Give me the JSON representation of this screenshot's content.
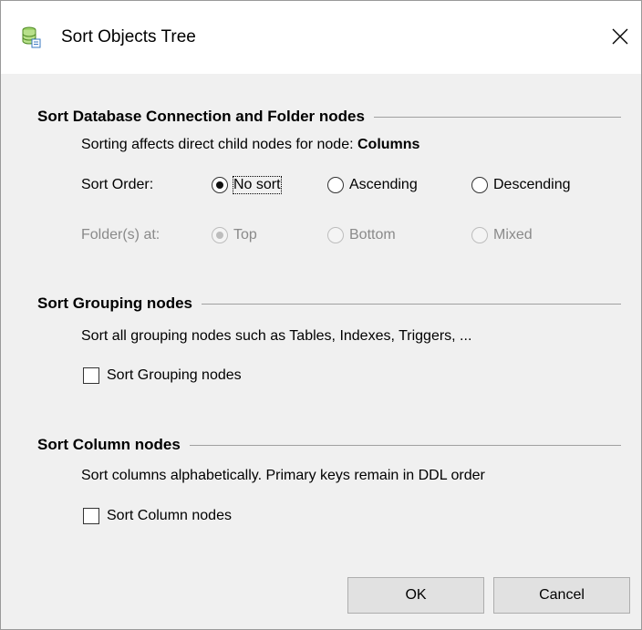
{
  "window": {
    "title": "Sort Objects Tree",
    "icon": "database-tree-icon",
    "close_glyph": "✕"
  },
  "section_connection": {
    "title": "Sort Database Connection and Folder nodes",
    "description_prefix": "Sorting affects direct child nodes for node: ",
    "description_node": "Columns",
    "sort_order_label": "Sort Order:",
    "sort_order_options": [
      "No sort",
      "Ascending",
      "Descending"
    ],
    "sort_order_selected": "No sort",
    "folders_label": "Folder(s) at:",
    "folders_options": [
      "Top",
      "Bottom",
      "Mixed"
    ],
    "folders_selected": "Top",
    "folders_disabled": true
  },
  "section_grouping": {
    "title": "Sort Grouping nodes",
    "description": "Sort all grouping nodes such as Tables, Indexes, Triggers, ...",
    "checkbox_label": "Sort Grouping nodes",
    "checked": false
  },
  "section_column": {
    "title": "Sort Column nodes",
    "description": "Sort columns alphabetically. Primary keys remain in DDL order",
    "checkbox_label": "Sort Column nodes",
    "checked": false
  },
  "buttons": {
    "ok": "OK",
    "cancel": "Cancel"
  }
}
